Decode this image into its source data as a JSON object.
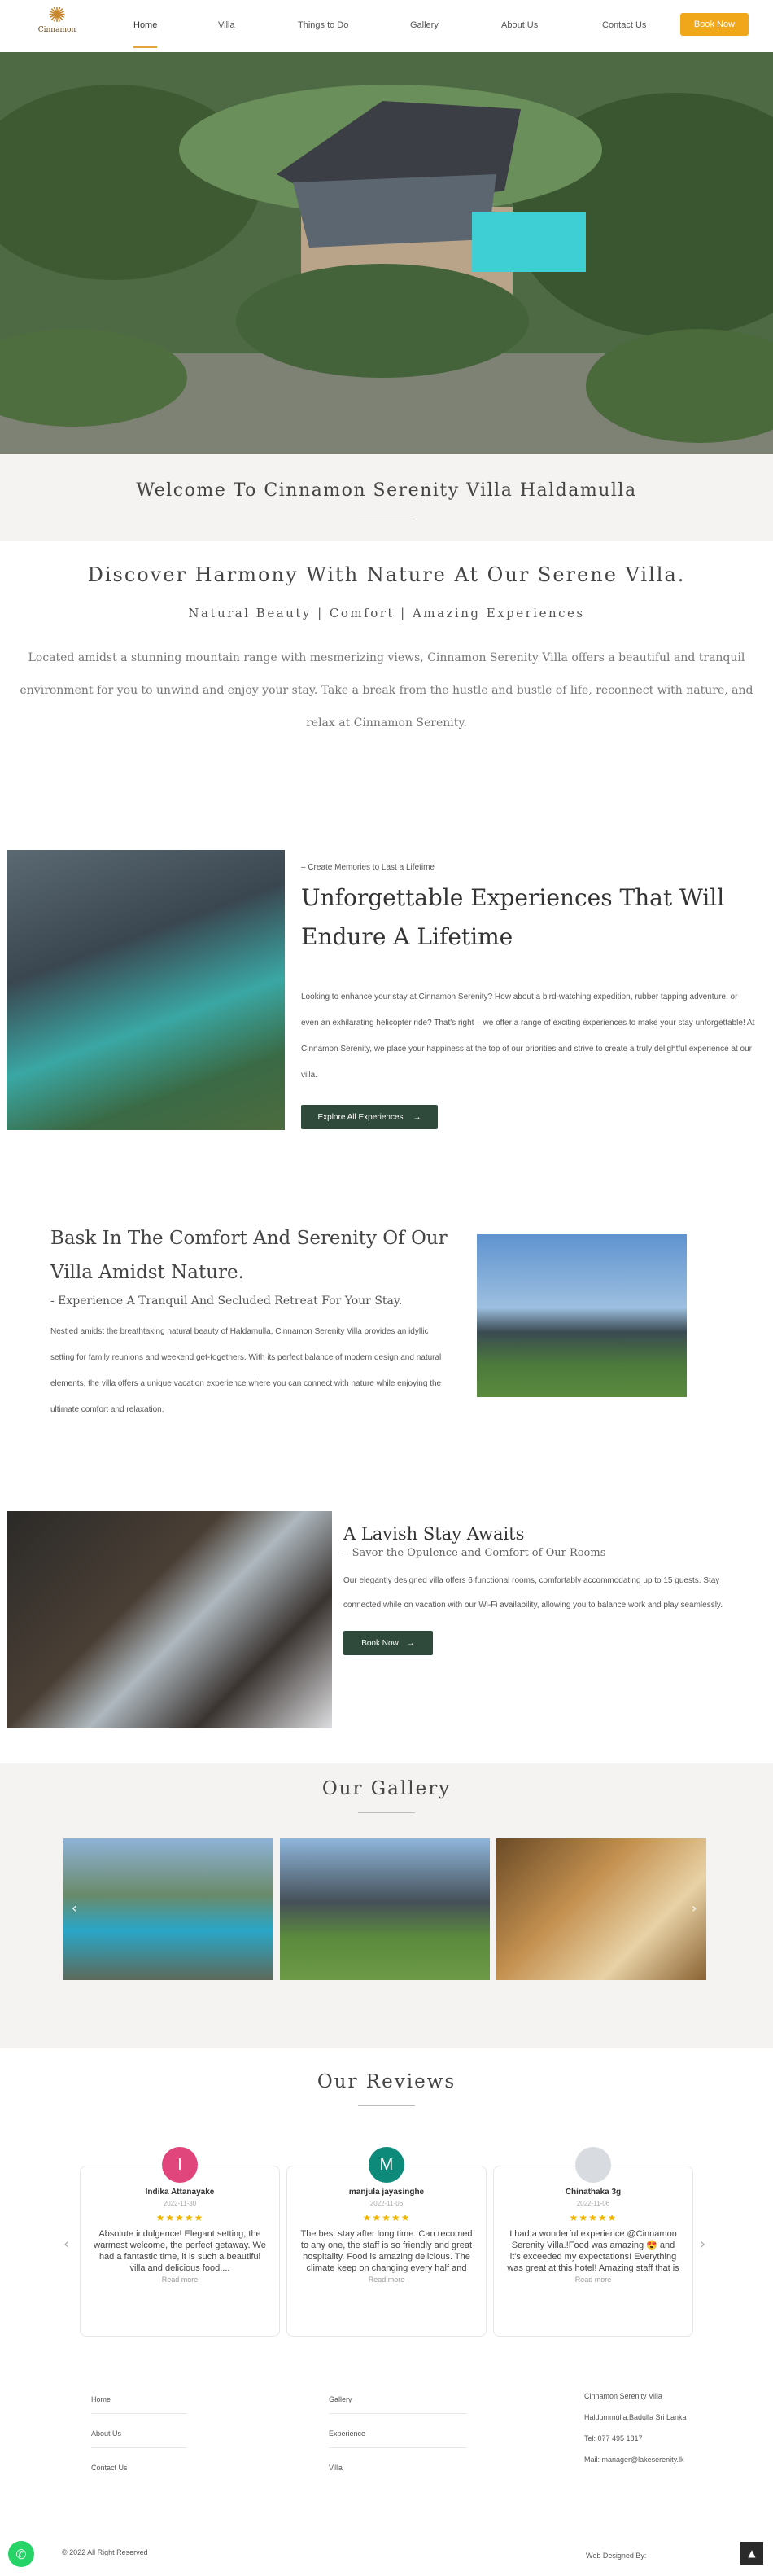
{
  "nav": {
    "logo": "Cinnamon",
    "items": [
      "Home",
      "Villa",
      "Things to Do",
      "Gallery",
      "About Us",
      "Contact Us"
    ],
    "book": "Book Now"
  },
  "welcome": {
    "title": "Welcome To Cinnamon Serenity Villa Haldamulla"
  },
  "intro": {
    "heading": "Discover Harmony With Nature At Our Serene Villa.",
    "subheading": "Natural Beauty | Comfort | Amazing Experiences",
    "text": "Located amidst a stunning mountain range with mesmerizing views, Cinnamon Serenity Villa offers a beautiful and tranquil environment for you to unwind and enjoy your stay. Take a break from the hustle and bustle of life, reconnect with nature, and relax at Cinnamon Serenity."
  },
  "experiences": {
    "kicker": "– Create Memories to Last a Lifetime",
    "heading": "Unforgettable Experiences That Will Endure A Lifetime",
    "text": "Looking to enhance your stay at Cinnamon Serenity? How about a bird-watching expedition, rubber tapping adventure, or even an exhilarating helicopter ride? That's right – we offer a range of exciting experiences to make your stay unforgettable! At Cinnamon Serenity, we place your happiness at the top of our priorities and strive to create a truly delightful experience at our villa.",
    "button": "Explore All Experiences"
  },
  "bask": {
    "heading": "Bask In The Comfort And Serenity Of Our Villa Amidst Nature.",
    "subheading": "- Experience A Tranquil And Secluded Retreat For Your Stay.",
    "text": "Nestled amidst the breathtaking natural beauty of Haldamulla, Cinnamon Serenity Villa provides an idyllic setting for family reunions and weekend get-togethers. With its perfect balance of modern design and natural elements, the villa offers a unique vacation experience where you can connect with nature while enjoying the ultimate comfort and relaxation."
  },
  "lavish": {
    "heading": "A Lavish Stay Awaits",
    "subheading": "– Savor the Opulence and Comfort of Our Rooms",
    "text": "Our elegantly designed villa offers 6 functional rooms, comfortably accommodating up to 15 guests. Stay connected while on vacation with our Wi-Fi availability, allowing you to balance work and play seamlessly.",
    "button": "Book Now"
  },
  "gallery": {
    "title": "Our Gallery"
  },
  "reviews": {
    "title": "Our Reviews",
    "items": [
      {
        "initial": "I",
        "color": "#e0457b",
        "name": "Indika Attanayake",
        "date": "2022-11-30",
        "stars": "★★★★★",
        "text": "Absolute indulgence! Elegant setting, the warmest welcome, the perfect getaway. We had a fantastic time, it is such a beautiful villa and delicious food....",
        "more": "Read more"
      },
      {
        "initial": "M",
        "color": "#0e8a7a",
        "name": "manjula jayasinghe",
        "date": "2022-11-06",
        "stars": "★★★★★",
        "text": "The best stay after long time. Can recomed to any one, the staff is so friendly and great hospitality. Food is amazing delicious. The climate keep on changing every half and hour you will...",
        "more": "Read more"
      },
      {
        "initial": "",
        "color": "#d8dbe0",
        "name": "Chinathaka 3g",
        "date": "2022-11-06",
        "stars": "★★★★★",
        "text": "I had a wonderful experience @Cinnamon Serenity Villa.!Food was amazing 😍 and it's exceeded my expectations! Everything was great at this hotel! Amazing staff that is friendl...",
        "more": "Read more"
      }
    ]
  },
  "footer": {
    "col1": [
      "Home",
      "About Us",
      "Contact Us"
    ],
    "col2": [
      "Gallery",
      "Experience",
      "Villa"
    ],
    "contact": [
      "Cinnamon Serenity Villa",
      "Haldummulla,Badulla Sri Lanka",
      "Tel: 077 495 1817",
      "Mail: manager@lakeserenity.lk"
    ],
    "copyright": "© 2022 All Right Reserved",
    "designer": "Web Designed By:"
  }
}
